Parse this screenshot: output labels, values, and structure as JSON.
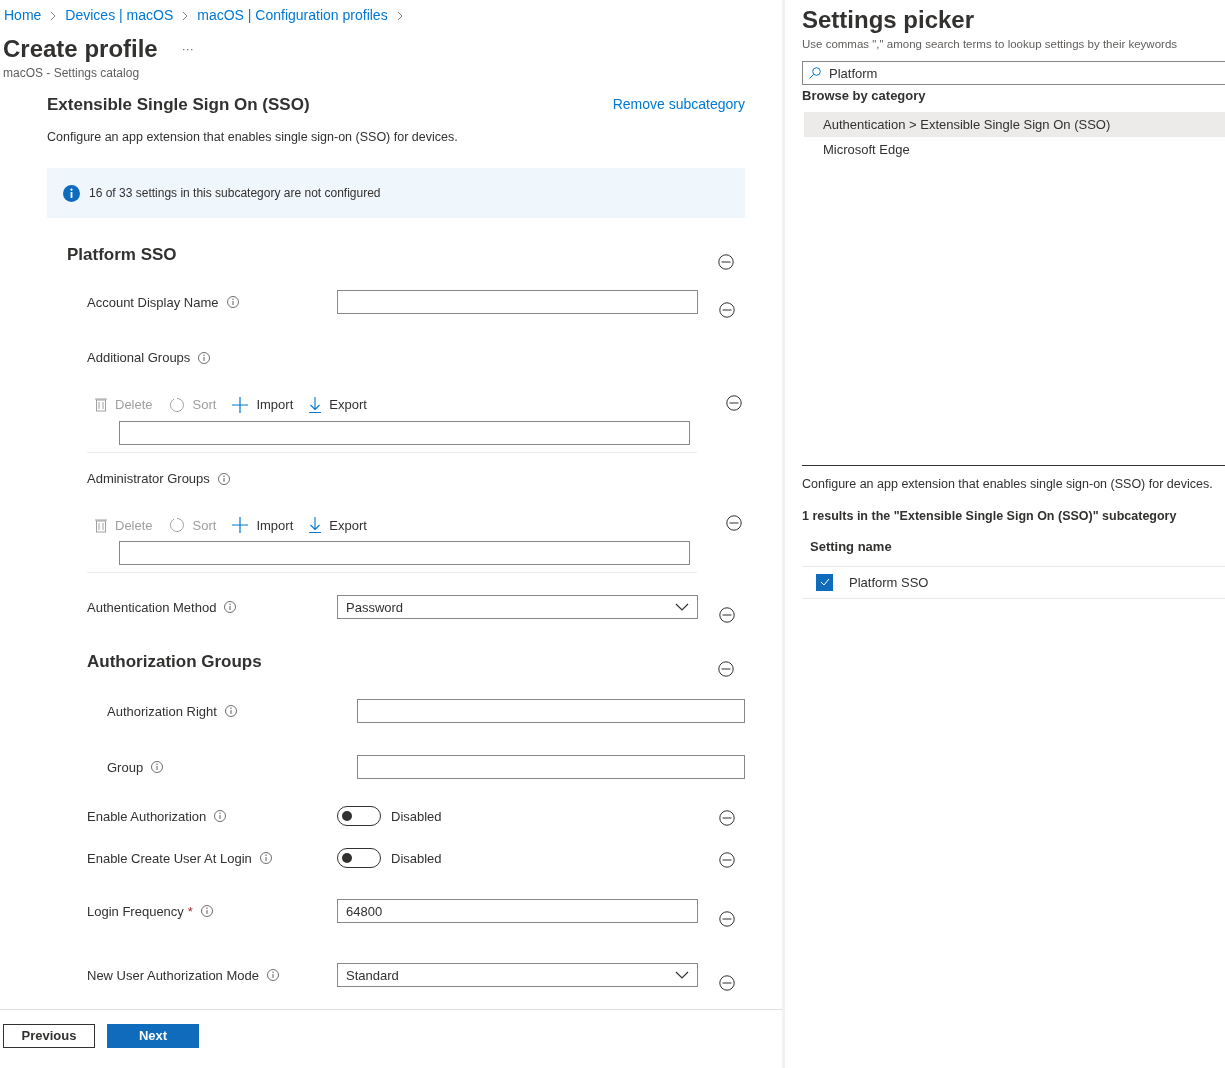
{
  "breadcrumb": [
    "Home",
    "Devices | macOS",
    "macOS | Configuration profiles"
  ],
  "page": {
    "title": "Create profile",
    "more": "···",
    "subtitle": "macOS - Settings catalog"
  },
  "subcategory": {
    "title": "Extensible Single Sign On (SSO)",
    "remove_link": "Remove subcategory",
    "description": "Configure an app extension that enables single sign-on (SSO) for devices.",
    "info": "16 of 33 settings in this subcategory are not configured"
  },
  "section": {
    "title": "Platform SSO",
    "settings": [
      {
        "kind": "text",
        "label": "Account Display Name"
      },
      {
        "kind": "list",
        "label": "Additional Groups",
        "actions": [
          {
            "kind": "delete",
            "label": "Delete",
            "disabled": true
          },
          {
            "kind": "sort",
            "label": "Sort",
            "disabled": true
          },
          {
            "kind": "import",
            "label": "Import",
            "disabled": false
          },
          {
            "kind": "export",
            "label": "Export",
            "disabled": false
          }
        ]
      },
      {
        "kind": "list",
        "label": "Administrator Groups",
        "actions": [
          {
            "kind": "delete",
            "label": "Delete",
            "disabled": true
          },
          {
            "kind": "sort",
            "label": "Sort",
            "disabled": true
          },
          {
            "kind": "import",
            "label": "Import",
            "disabled": false
          },
          {
            "kind": "export",
            "label": "Export",
            "disabled": false
          }
        ]
      },
      {
        "kind": "dropdown",
        "label": "Authentication Method",
        "value": "Password"
      },
      {
        "kind": "group",
        "title": "Authorization Groups",
        "children": [
          {
            "kind": "text",
            "label": "Authorization Right"
          },
          {
            "kind": "text",
            "label": "Group"
          }
        ]
      },
      {
        "kind": "toggle",
        "label": "Enable Authorization",
        "on": false,
        "state_label": "Disabled"
      },
      {
        "kind": "toggle",
        "label": "Enable Create User At Login",
        "on": false,
        "state_label": "Disabled"
      },
      {
        "kind": "text",
        "label": "Login Frequency",
        "value": "64800",
        "required_mark": "*"
      },
      {
        "kind": "dropdown",
        "label": "New User Authorization Mode",
        "value": "Standard"
      }
    ]
  },
  "footer": {
    "buttons": [
      {
        "label": "Previous",
        "primary": false
      },
      {
        "label": "Next",
        "primary": true
      }
    ]
  },
  "picker": {
    "title": "Settings picker",
    "hint": "Use commas \",\" among search terms to lookup settings by their keywords",
    "search": "Platform",
    "browse_label": "Browse by category",
    "categories": [
      {
        "label": "Authentication > Extensible Single Sign On (SSO)",
        "selected": true
      },
      {
        "label": "Microsoft Edge",
        "selected": false
      }
    ],
    "description": "Configure an app extension that enables single sign-on (SSO) for devices.",
    "results": "1 results in the \"Extensible Single Sign On (SSO)\" subcategory",
    "column": "Setting name",
    "rows": [
      {
        "name": "Platform SSO",
        "checked": true
      }
    ]
  }
}
